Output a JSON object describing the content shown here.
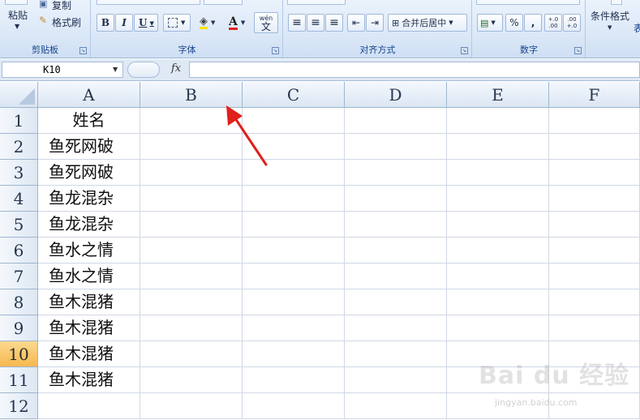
{
  "ribbon": {
    "clipboard": {
      "paste_label": "粘贴",
      "copy_label": "复制",
      "format_painter_label": "格式刷",
      "group_label": "剪贴板"
    },
    "font": {
      "bold": "B",
      "italic": "I",
      "underline": "U",
      "font_color_glyph": "A",
      "phonetic_glyph": "wén\n文",
      "group_label": "字体"
    },
    "alignment": {
      "merge_center_label": "合并后居中",
      "group_label": "对齐方式"
    },
    "number": {
      "percent": "%",
      "comma": ",",
      "inc_decimal": "+.0 .00",
      "dec_decimal": ".00 +.0",
      "group_label": "数字"
    },
    "styles": {
      "conditional_format_label": "条件格式",
      "table_format_partial": "表"
    }
  },
  "formula_bar": {
    "name_box_value": "K10",
    "fx_label": "fx",
    "formula_value": ""
  },
  "sheet": {
    "columns": [
      "A",
      "B",
      "C",
      "D",
      "E",
      "F"
    ],
    "rows": [
      "1",
      "2",
      "3",
      "4",
      "5",
      "6",
      "7",
      "8",
      "9",
      "10",
      "11",
      "12"
    ],
    "active_row": "10",
    "column_a": [
      "姓名",
      "鱼死网破",
      "鱼死网破",
      "鱼龙混杂",
      "鱼龙混杂",
      "鱼水之情",
      "鱼水之情",
      "鱼木混猪",
      "鱼木混猪",
      "鱼木混猪",
      "鱼木混猪",
      ""
    ]
  },
  "watermark": {
    "main": "Bai du 经验",
    "sub": "jingyan.baidu.com"
  },
  "colors": {
    "annotation_arrow": "#e0201b",
    "active_row_header": "#f6c46a",
    "ribbon_label": "#15428b"
  }
}
